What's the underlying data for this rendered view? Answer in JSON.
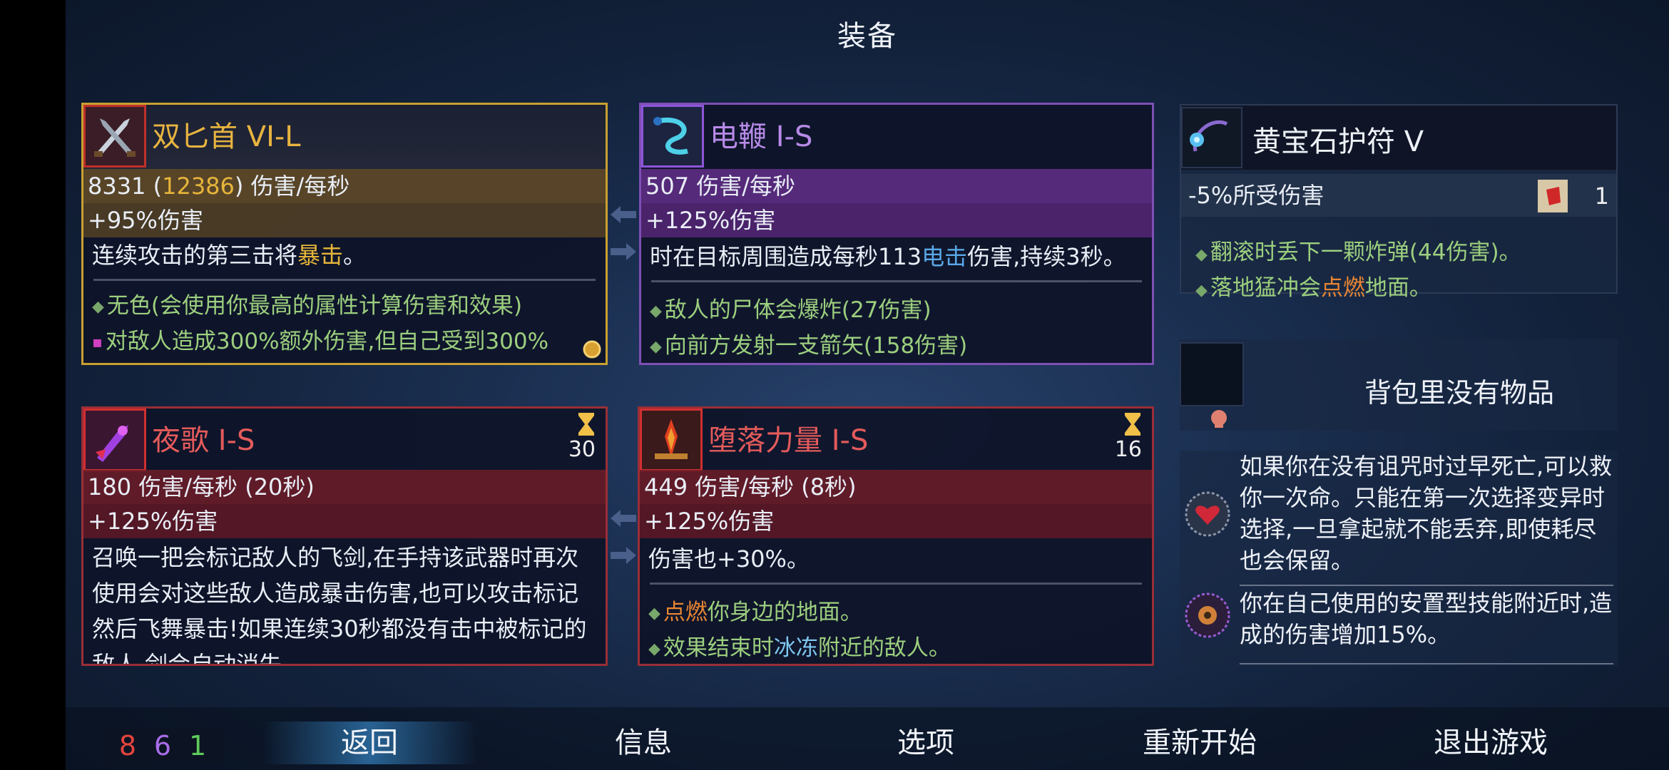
{
  "screen": {
    "title": "装备"
  },
  "weapons": [
    {
      "name": "双匕首 VI-L",
      "stat_main": "8331",
      "stat_paren": "12386",
      "stat_unit": "伤害/每秒",
      "stat_bonus": "+95%伤害",
      "desc_pre": "连续攻击的第三击将",
      "desc_hl": "暴击",
      "desc_post": "。",
      "effects": [
        "无色(会使用你最高的属性计算伤害和效果)",
        "对敌人造成300%额外伤害,但自己受到300%"
      ]
    },
    {
      "name": "电鞭 I-S",
      "stat_main": "507 伤害/每秒",
      "stat_bonus": "+125%伤害",
      "desc_pre": "时在目标周围造成每秒113",
      "desc_hl": "电击",
      "desc_post": "伤害,持续3秒。",
      "effects": [
        "敌人的尸体会爆炸(27伤害)",
        "向前方发射一支箭矢(158伤害)"
      ]
    },
    {
      "name": "夜歌 I-S",
      "timer": "30",
      "stat_main": "180 伤害/每秒 (20秒)",
      "stat_bonus": "+125%伤害",
      "desc": "召唤一把会标记敌人的飞剑,在手持该武器时再次使用会对这些敌人造成暴击伤害,也可以攻击标记然后飞舞暴击!如果连续30秒都没有击中被标记的敌人,剑会自动消失"
    },
    {
      "name": "堕落力量 I-S",
      "timer": "16",
      "stat_main": "449 伤害/每秒 (8秒)",
      "stat_bonus": "+125%伤害",
      "desc": "伤害也+30%。",
      "effect1_hl": "点燃",
      "effect1_post": "你身边的地面。",
      "effect2_pre": "效果结束时",
      "effect2_hl": "冰冻",
      "effect2_post": "附近的敌人。"
    }
  ],
  "amulet": {
    "name": "黄宝石护符 V",
    "stat": "-5%所受伤害",
    "scroll_count": "1",
    "effect1": "翻滚时丢下一颗炸弹(44伤害)。",
    "effect2_pre": "落地猛冲会",
    "effect2_hl": "点燃",
    "effect2_post": "地面。"
  },
  "backpack": {
    "empty_text": "背包里没有物品"
  },
  "mutations": [
    {
      "icon": "heart-mutation-icon",
      "text": "如果你在没有诅咒时过早死亡,可以救你一次命。只能在第一次选择变异时选择,一旦拿起就不能丢弃,即使耗尽也会保留。"
    },
    {
      "icon": "trap-mutation-icon",
      "text": "你在自己使用的安置型技能附近时,造成的伤害增加15%。"
    }
  ],
  "scroll_counts": {
    "red": "8",
    "purple": "6",
    "green": "1"
  },
  "colors": {
    "red": "#e5443e",
    "purple": "#a86de8",
    "green": "#5fcc5a"
  },
  "menu": [
    "返回",
    "信息",
    "选项",
    "重新开始",
    "退出游戏"
  ]
}
